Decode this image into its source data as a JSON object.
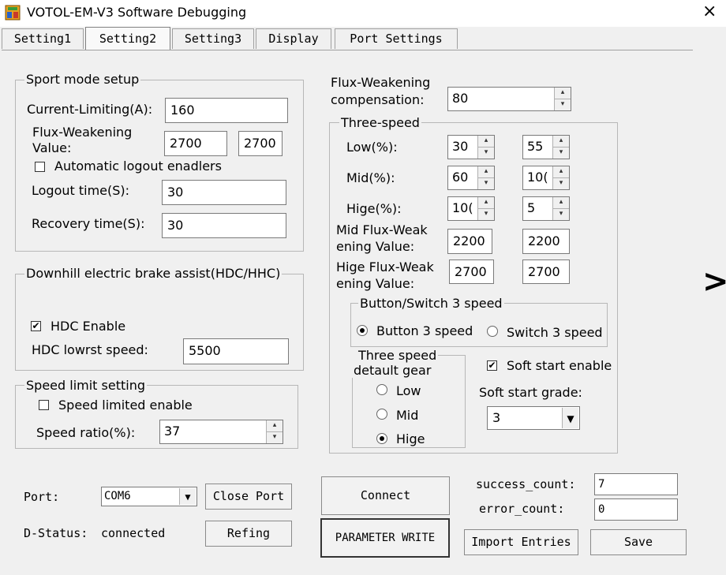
{
  "window": {
    "title": "VOTOL-EM-V3 Software Debugging",
    "close_glyph": "×"
  },
  "tabs": [
    "Setting1",
    "Setting2",
    "Setting3",
    "Display",
    "Port Settings"
  ],
  "active_tab": "Setting2",
  "sport_mode": {
    "legend": "Sport mode setup",
    "current_limiting_label": "Current-Limiting(A):",
    "current_limiting_value": "160",
    "flux_label_line1": "Flux-Weakening",
    "flux_label_line2": "Value:",
    "flux_value_1": "2700",
    "flux_value_2": "2700",
    "auto_logout_label": "Automatic logout enadlers",
    "auto_logout_checked": false,
    "logout_time_label": "Logout time(S):",
    "logout_time_value": "30",
    "recovery_time_label": "Recovery time(S):",
    "recovery_time_value": "30"
  },
  "hdc": {
    "legend": "Downhill electric brake assist(HDC/HHC)",
    "enable_label": "HDC Enable",
    "enable_checked": true,
    "lowest_speed_label": "HDC lowrst speed:",
    "lowest_speed_value": "5500"
  },
  "speed_limit": {
    "legend": "Speed limit setting",
    "enable_label": "Speed limited enable",
    "enable_checked": false,
    "ratio_label": "Speed ratio(%):",
    "ratio_value": "37"
  },
  "flux_comp": {
    "label_line1": "Flux-Weakening",
    "label_line2": "compensation:",
    "value": "80"
  },
  "three_speed": {
    "legend": "Three-speed",
    "low_label": "Low(%):",
    "low_1": "30",
    "low_2": "55",
    "mid_label": "Mid(%):",
    "mid_1": "60",
    "mid_2": "10(",
    "hige_label": "Hige(%):",
    "hige_1": "10(",
    "hige_2": "5",
    "mid_flux_line1": "Mid Flux-Weak",
    "mid_flux_line2": "ening Value:",
    "mid_flux_1": "2200",
    "mid_flux_2": "2200",
    "hige_flux_line1": "Hige Flux-Weak",
    "hige_flux_line2": "ening Value:",
    "hige_flux_1": "2700",
    "hige_flux_2": "2700",
    "button_switch_legend": "Button/Switch 3 speed",
    "button_3_speed": "Button 3 speed",
    "switch_3_speed": "Switch 3 speed",
    "button_switch_selected": "button",
    "default_gear_legend_line1": "Three speed",
    "default_gear_legend_line2": "detault gear",
    "gear_low": "Low",
    "gear_mid": "Mid",
    "gear_hige": "Hige",
    "gear_selected": "hige",
    "soft_start_label": "Soft start enable",
    "soft_start_checked": true,
    "soft_start_grade_label": "Soft start grade:",
    "soft_start_grade_value": "3"
  },
  "side_arrow": ">",
  "bottom": {
    "port_label": "Port:",
    "port_value": "COM6",
    "close_port": "Close Port",
    "status_label": "D-Status:",
    "status_value": "connected",
    "refing": "Refing",
    "connect": "Connect",
    "parameter_write": "PARAMETER WRITE",
    "success_label": "success_count:",
    "success_value": "7",
    "error_label": "error_count:",
    "error_value": "0",
    "import_entries": "Import Entries",
    "save": "Save"
  }
}
